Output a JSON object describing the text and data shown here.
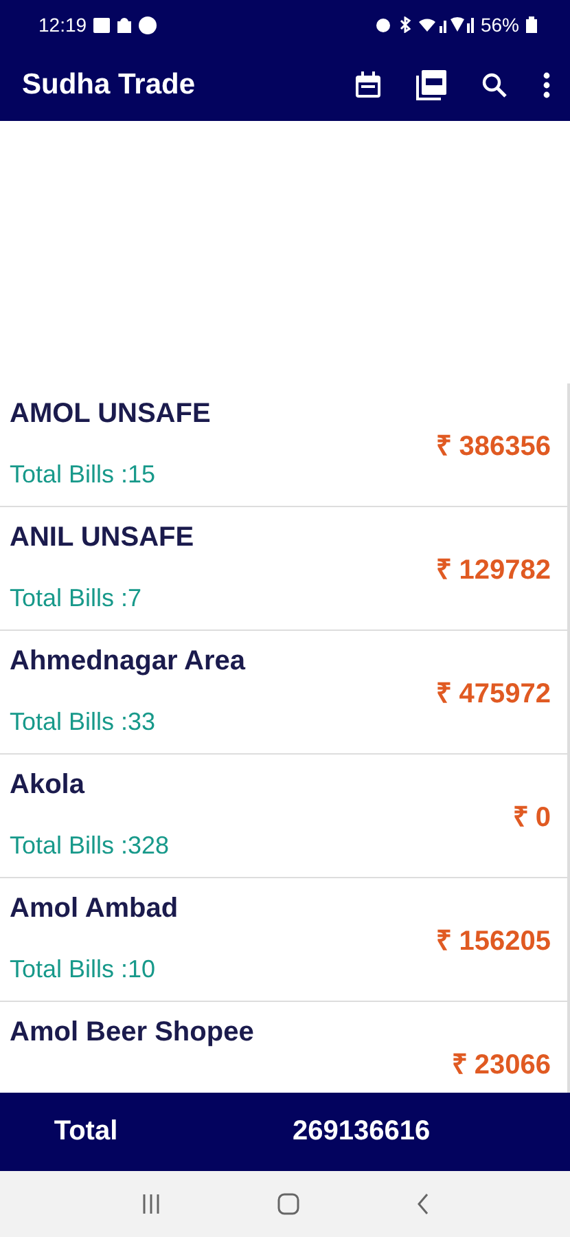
{
  "status_bar": {
    "time": "12:19",
    "battery": "56%"
  },
  "app_bar": {
    "title": "Sudha Trade"
  },
  "parties": [
    {
      "name": "AMOL UNSAFE",
      "bills": "Total Bills :15",
      "amount": "₹ 386356"
    },
    {
      "name": "ANIL UNSAFE",
      "bills": "Total Bills :7",
      "amount": "₹ 129782"
    },
    {
      "name": "Ahmednagar Area",
      "bills": "Total Bills :33",
      "amount": "₹ 475972"
    },
    {
      "name": "Akola",
      "bills": "Total Bills :328",
      "amount": "₹ 0"
    },
    {
      "name": "Amol Ambad",
      "bills": "Total Bills :10",
      "amount": "₹ 156205"
    },
    {
      "name": "Amol Beer Shopee",
      "amount": "₹ 23066"
    }
  ],
  "footer": {
    "label": "Total",
    "value": "269136616"
  }
}
